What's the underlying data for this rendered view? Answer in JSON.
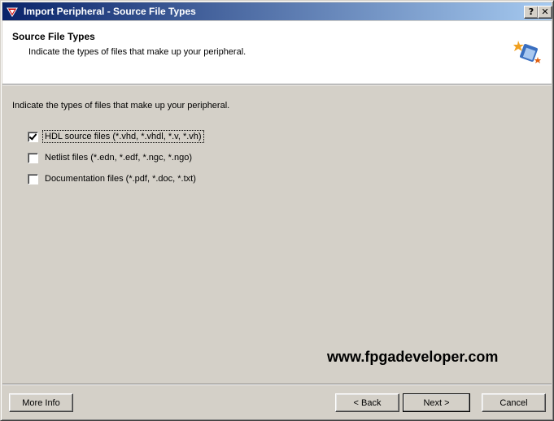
{
  "window": {
    "title": "Import Peripheral - Source File Types",
    "help_label": "?",
    "close_label": "✕"
  },
  "header": {
    "title": "Source File Types",
    "subtitle": "Indicate the types of files that make up your peripheral."
  },
  "body": {
    "intro": "Indicate the types of files that make up your peripheral.",
    "options": [
      {
        "label": "HDL source files (*.vhd, *.vhdl, *.v, *.vh)",
        "checked": true
      },
      {
        "label": "Netlist files (*.edn, *.edf, *.ngc, *.ngo)",
        "checked": false
      },
      {
        "label": "Documentation files (*.pdf, *.doc, *.txt)",
        "checked": false
      }
    ],
    "watermark": "www.fpgadeveloper.com"
  },
  "footer": {
    "more_info": "More Info",
    "back": "< Back",
    "next": "Next >",
    "cancel": "Cancel"
  }
}
